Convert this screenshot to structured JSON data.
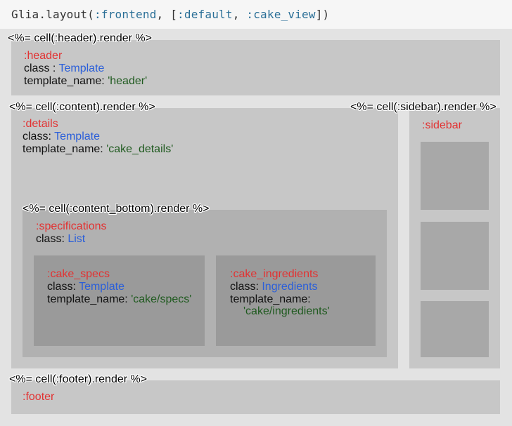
{
  "code": {
    "obj": "Glia",
    "dot": ".",
    "method": "layout",
    "open": "(",
    "arg1": ":frontend",
    "sep1": ", [",
    "arg2": ":default",
    "sep2": ", ",
    "arg3": ":cake_view",
    "close": "])"
  },
  "cells": {
    "header": {
      "render": "<%= cell(:header).render %>",
      "name": ":header",
      "class_key": "class : ",
      "class_val": "Template",
      "tpl_key": "template_name: ",
      "tpl_val": "'header'"
    },
    "content": {
      "render": "<%= cell(:content).render %>",
      "name": ":details",
      "class_key": "class: ",
      "class_val": "Template",
      "tpl_key": "template_name: ",
      "tpl_val": "'cake_details'"
    },
    "sidebar": {
      "render": "<%= cell(:sidebar).render %>",
      "name": ":sidebar"
    },
    "content_bottom": {
      "render": "<%= cell(:content_bottom).render %>",
      "name": ":specifications",
      "class_key": "class: ",
      "class_val": "List"
    },
    "cake_specs": {
      "name": ":cake_specs",
      "class_key": "class: ",
      "class_val": "Template",
      "tpl_key": "template_name: ",
      "tpl_val": "'cake/specs'"
    },
    "cake_ingredients": {
      "name": ":cake_ingredients",
      "class_key": "class: ",
      "class_val": "Ingredients",
      "tpl_key": "template_name:",
      "tpl_val": "'cake/ingredients'"
    },
    "footer": {
      "render": "<%= cell(:footer).render %>",
      "name": ":footer"
    }
  }
}
